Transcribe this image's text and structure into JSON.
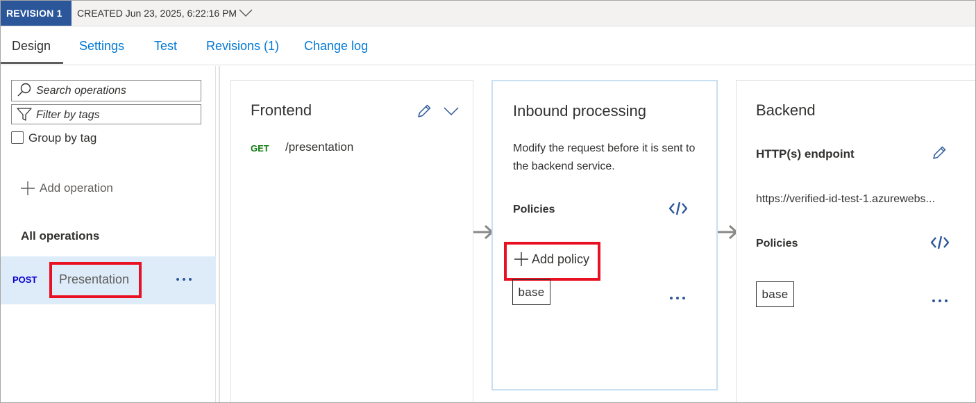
{
  "revision": {
    "badge": "REVISION 1",
    "created": "CREATED Jun 23, 2025, 6:22:16 PM"
  },
  "tabs": [
    {
      "label": "Design",
      "active": true
    },
    {
      "label": "Settings"
    },
    {
      "label": "Test"
    },
    {
      "label": "Revisions (1)"
    },
    {
      "label": "Change log"
    }
  ],
  "sidebar": {
    "search_placeholder": "Search operations",
    "filter_placeholder": "Filter by tags",
    "group_by_tag": "Group by tag",
    "add_operation": "Add operation",
    "all_operations": "All operations",
    "operations": [
      {
        "method": "POST",
        "name": "Presentation"
      }
    ]
  },
  "frontend": {
    "title": "Frontend",
    "method": "GET",
    "path": "/presentation"
  },
  "inbound": {
    "title": "Inbound processing",
    "description": "Modify the request before it is sent to the backend service.",
    "policies_label": "Policies",
    "add_policy": "Add policy",
    "base_tag": "base"
  },
  "backend": {
    "title": "Backend",
    "endpoint_label": "HTTP(s) endpoint",
    "endpoint_url": "https://verified-id-test-1.azurewebs...",
    "policies_label": "Policies",
    "base_tag": "base"
  },
  "colors": {
    "accent": "#0078d4",
    "revision_badge": "#2b579a",
    "highlight_border": "#e81123",
    "selected_row": "#deecf9",
    "get_method": "#107c10",
    "post_method": "#0b00cc"
  }
}
